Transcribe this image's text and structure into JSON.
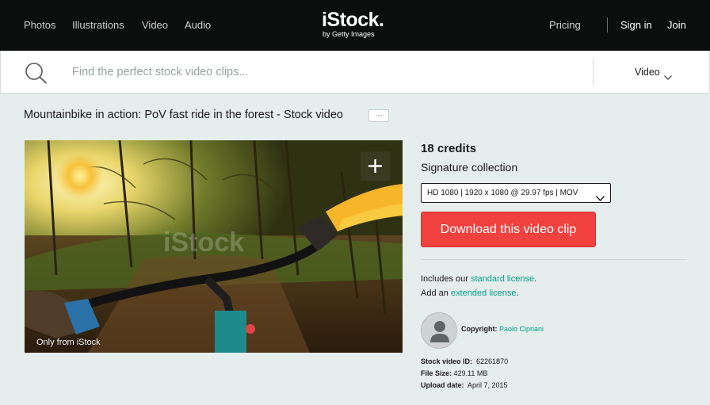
{
  "nav": {
    "links": [
      "Photos",
      "Illustrations",
      "Video",
      "Audio"
    ],
    "pricing": "Pricing",
    "sign_in": "Sign in",
    "join": "Join"
  },
  "logo": {
    "main": "iStock.",
    "sub": "by Getty Images"
  },
  "search": {
    "placeholder": "Find the perfect stock video clips...",
    "value": "",
    "type_label": "Video"
  },
  "asset": {
    "title": "Mountainbike in action: PoV fast ride in the forest - Stock video",
    "more_label": "···",
    "exclusive_label": "Only from iStock",
    "watermark": "iStock"
  },
  "purchase": {
    "credits": "18 credits",
    "collection": "Signature collection",
    "format": "HD 1080 | 1920 x 1080 @ 29.97 fps | MOV",
    "download_label": "Download this video clip"
  },
  "license": {
    "line1_prefix": "Includes our",
    "line1_link": "standard license",
    "line1_suffix": ".",
    "line2_prefix": "Add an",
    "line2_link": "extended license",
    "line2_suffix": "."
  },
  "contributor": {
    "label": "Copyright:",
    "name": "Paolo Cipriani"
  },
  "details": {
    "id_label": "Stock video ID:",
    "id_value": "62261870",
    "size_label": "File Size:",
    "size_value": "429.11 MB",
    "date_label": "Upload date:",
    "date_value": "April 7, 2015"
  },
  "colors": {
    "nav_bg": "#0c0d0d",
    "page_bg": "#e6eded",
    "download_red": "#f1423f",
    "link_teal": "#02a388"
  },
  "icons": [
    "search-icon",
    "chevron-down-icon",
    "plus-icon",
    "user-avatar-icon"
  ]
}
